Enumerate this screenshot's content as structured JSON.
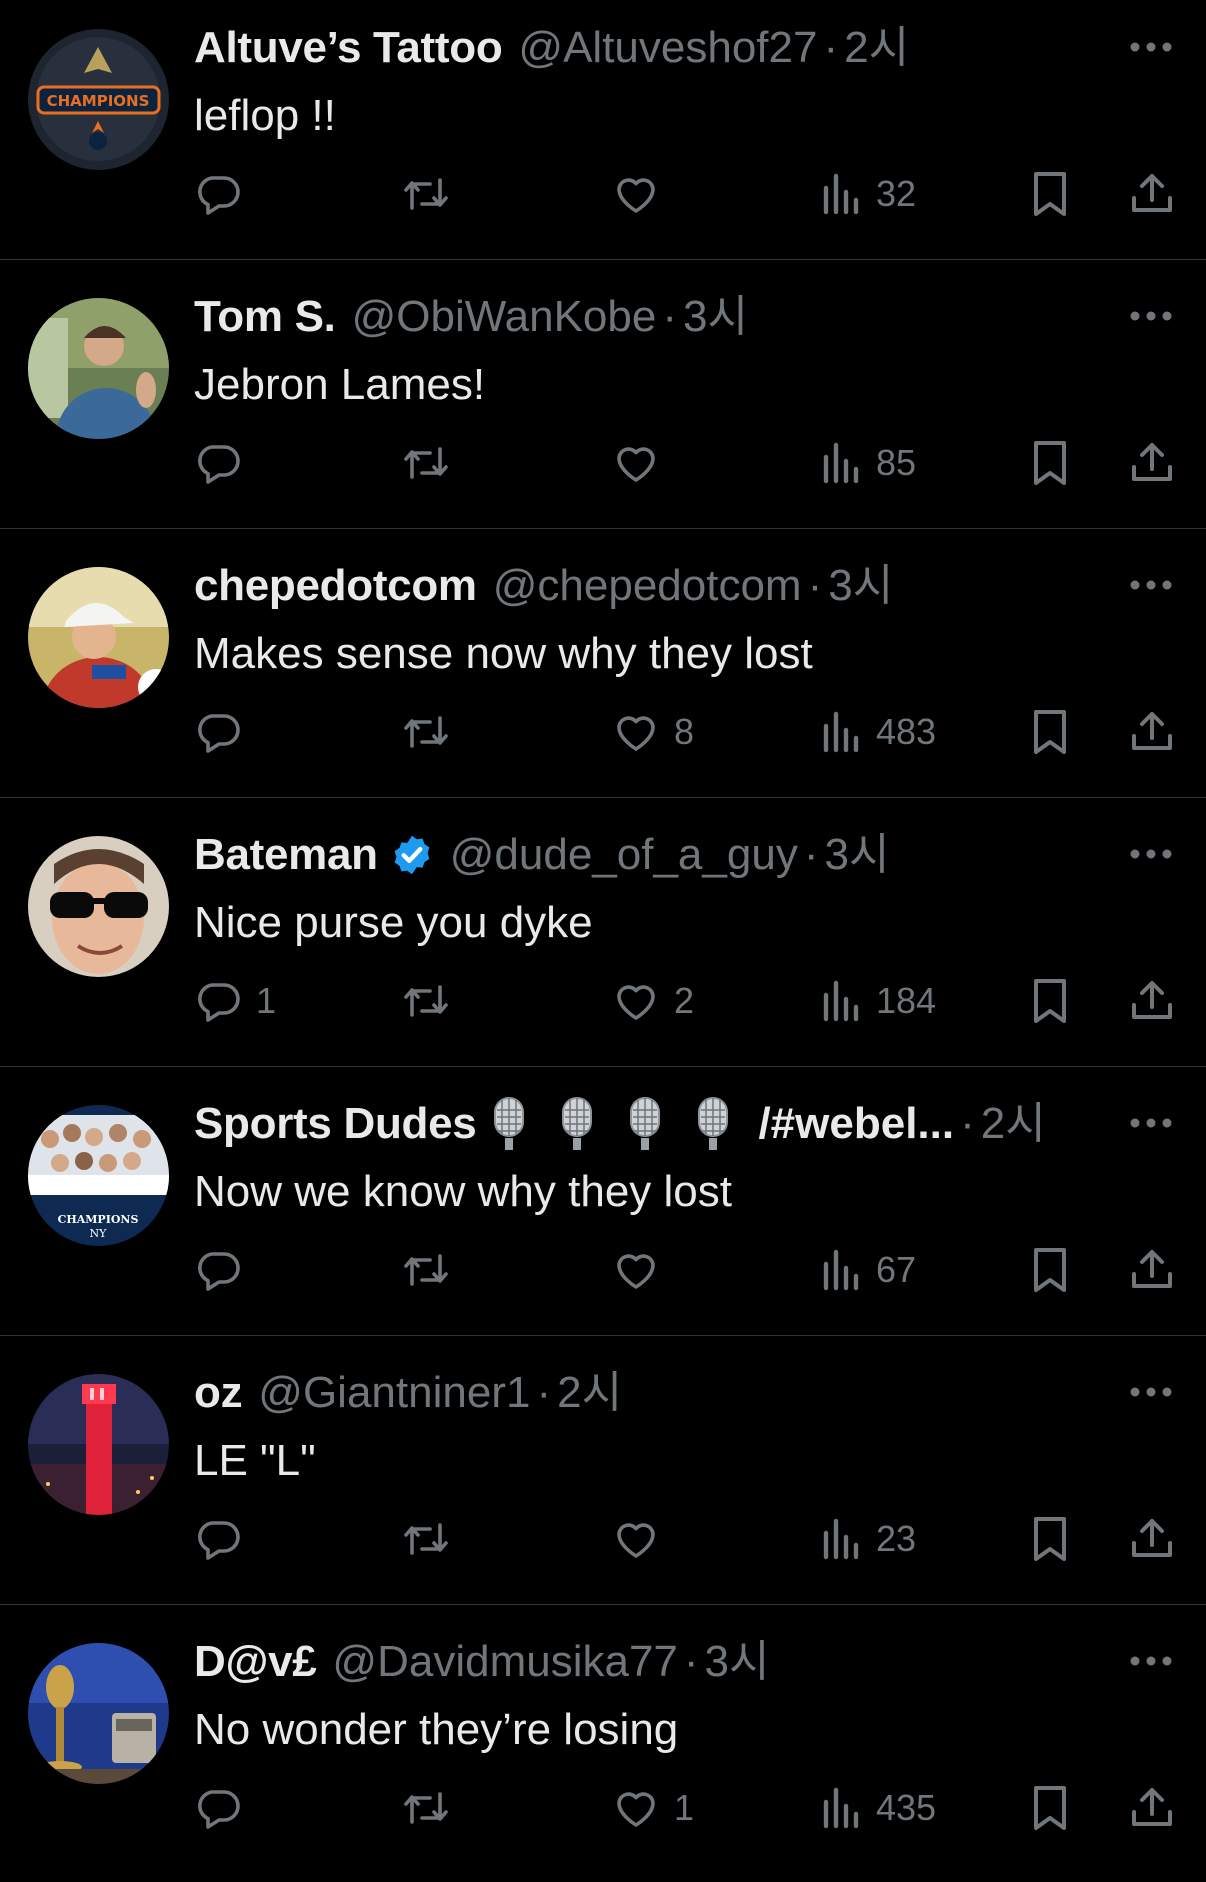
{
  "tweets": [
    {
      "name": "Altuve’s Tattoo",
      "handle": "@Altuveshof27",
      "separator": "·",
      "time": "2시",
      "text": "leflop !!",
      "replies": "",
      "retweets": "",
      "likes": "",
      "views": "32"
    },
    {
      "name": "Tom S.",
      "handle": "@ObiWanKobe",
      "separator": "·",
      "time": "3시",
      "text": "Jebron Lames!",
      "replies": "",
      "retweets": "",
      "likes": "",
      "views": "85"
    },
    {
      "name": "chepedotcom",
      "handle": "@chepedotcom",
      "separator": "·",
      "time": "3시",
      "text": "Makes sense now why they lost",
      "replies": "",
      "retweets": "",
      "likes": "8",
      "views": "483"
    },
    {
      "name": "Bateman",
      "handle": "@dude_of_a_guy",
      "separator": "·",
      "time": "3시",
      "text": "Nice purse you dyke",
      "replies": "1",
      "retweets": "",
      "likes": "2",
      "views": "184",
      "verified": true
    },
    {
      "name": "Sports Dudes",
      "name_suffix": "/#webel...",
      "handle": "",
      "separator": "·",
      "time": "2시",
      "text": "Now we know why they lost",
      "replies": "",
      "retweets": "",
      "likes": "",
      "views": "67",
      "emoji": "microphone-icon x4"
    },
    {
      "name": "oz",
      "handle": "@Giantniner1",
      "separator": "·",
      "time": "2시",
      "text": "LE \"L\"",
      "replies": "",
      "retweets": "",
      "likes": "",
      "views": "23"
    },
    {
      "name": "D@v£",
      "handle": "@Davidmusika77",
      "separator": "·",
      "time": "3시",
      "text": "No wonder they’re losing",
      "replies": "",
      "retweets": "",
      "likes": "1",
      "views": "435"
    }
  ],
  "colors": {
    "background": "#000000",
    "text": "#e7e9ea",
    "muted": "#71767b",
    "divider": "#2f3336",
    "verified": "#1d9bf0"
  }
}
